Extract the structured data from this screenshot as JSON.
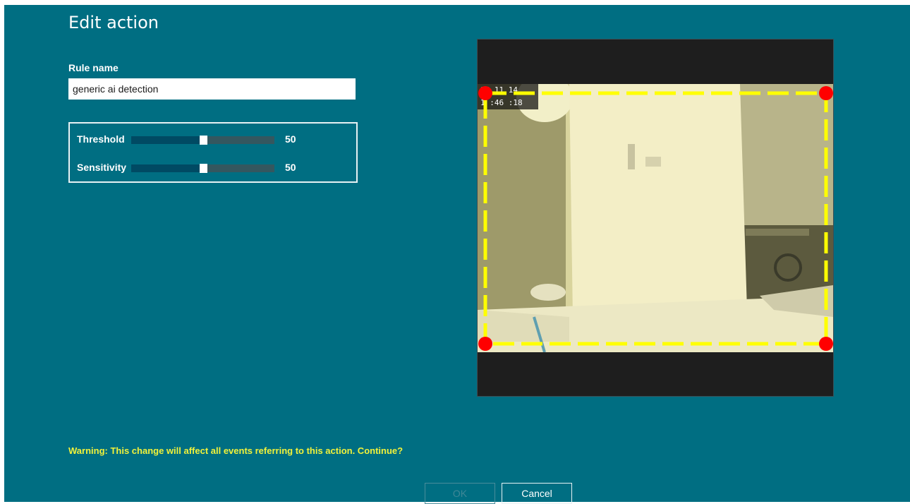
{
  "dialog": {
    "title": "Edit action",
    "background_color": "#006e82"
  },
  "rule": {
    "label": "Rule name",
    "value": "generic ai detection"
  },
  "sliders": [
    {
      "label": "Threshold",
      "value": "50",
      "fraction": 0.5
    },
    {
      "label": "Sensitivity",
      "value": "50",
      "fraction": 0.5
    }
  ],
  "preview": {
    "timestamp_line1": "14 11 14",
    "timestamp_line2": "1 :46 :18",
    "roi_color": "#ffff00",
    "handle_color": "#ff0000"
  },
  "footer": {
    "warning": "Warning: This change will affect all events referring to this action. Continue?",
    "warning_color": "#f2f23a",
    "ok_label": "OK",
    "cancel_label": "Cancel"
  }
}
